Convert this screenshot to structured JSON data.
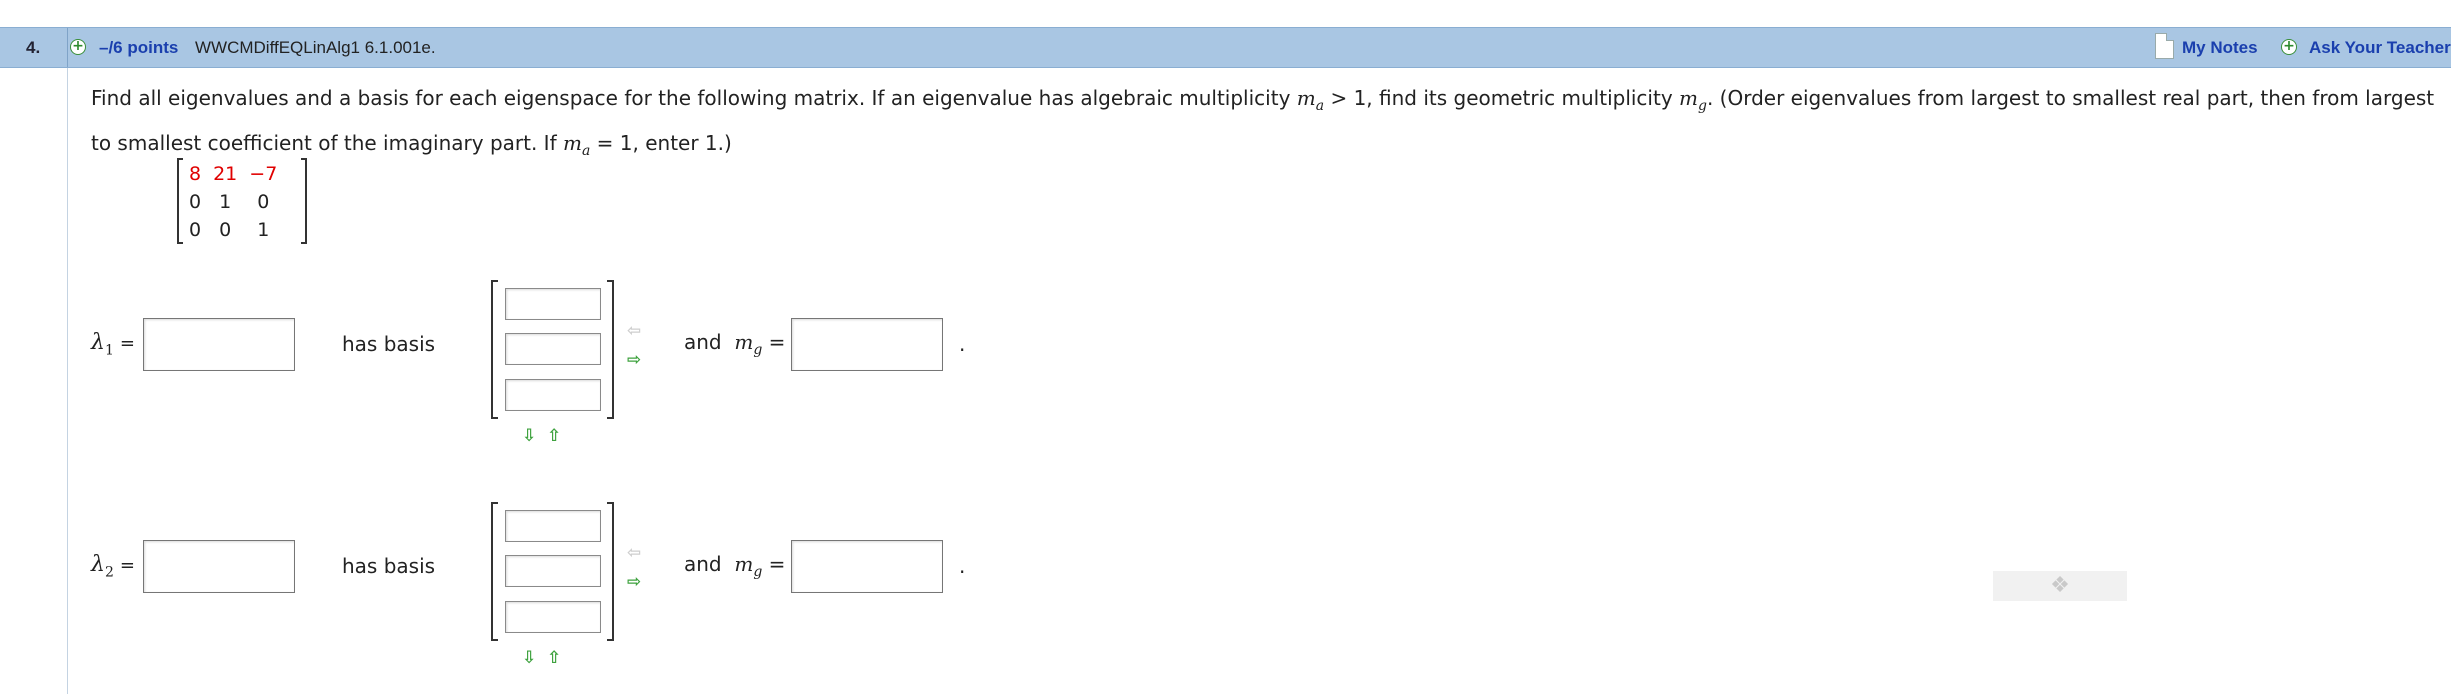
{
  "header": {
    "question_number": "4.",
    "points": "–/6 points",
    "question_id": "WWCMDiffEQLinAlg1 6.1.001e.",
    "my_notes": "My Notes",
    "ask_teacher": "Ask Your Teacher"
  },
  "prompt": {
    "p1": "Find all eigenvalues and a basis for each eigenspace for the following matrix. If an eigenvalue has algebraic multiplicity ",
    "m": "m",
    "a": "a",
    "p2": " > 1,  find its geometric multiplicity ",
    "g": "g",
    "p3": ". (Order eigenvalues from largest to smallest real part, then from largest to smallest coefficient of the imaginary part. If ",
    "p4": " = 1,  enter 1.)"
  },
  "matrix": [
    [
      "8",
      "21",
      "−7"
    ],
    [
      "0",
      "1",
      "0"
    ],
    [
      "0",
      "0",
      "1"
    ]
  ],
  "rows": [
    {
      "lambda": "λ",
      "index": "1",
      "equals": "=",
      "has_basis": "has basis",
      "and": "and",
      "mg_sym": "m",
      "mg_sub": "g",
      "mg_eq": "=",
      "period": "."
    },
    {
      "lambda": "λ",
      "index": "2",
      "equals": "=",
      "has_basis": "has basis",
      "and": "and",
      "mg_sym": "m",
      "mg_sub": "g",
      "mg_eq": "=",
      "period": "."
    }
  ],
  "icons": {
    "plus": "+",
    "arrow_left": "⇦",
    "arrow_right": "⇨",
    "arrow_down": "⇩",
    "arrow_up": "⇧",
    "puzzle": "❖"
  },
  "colors": {
    "header_bg": "#a9c6e3",
    "link": "#1a3fae",
    "matrix_highlight": "#e00000",
    "arrow_active": "#3fa23f",
    "arrow_disabled": "#cfcfcf"
  }
}
